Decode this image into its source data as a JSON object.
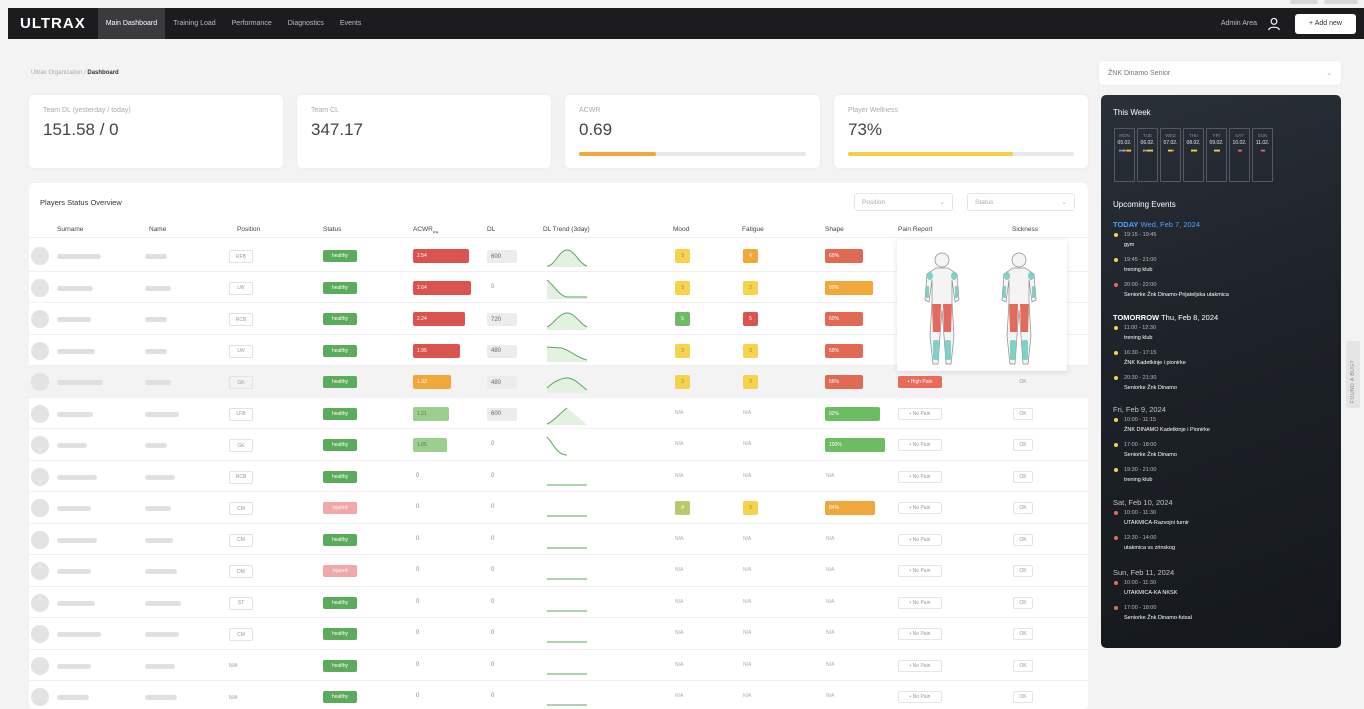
{
  "nav": {
    "logo": "ULTRAX",
    "items": [
      "Main Dashboard",
      "Training Load",
      "Performance",
      "Diagnostics",
      "Events"
    ],
    "admin": "Admin Area",
    "add_new": "+ Add new"
  },
  "breadcrumb": {
    "org": "Ultrax Organization",
    "sep": " / ",
    "page": "Dashboard"
  },
  "team_select": {
    "value": "ŽNK Dinamo Senior"
  },
  "cards": [
    {
      "label": "Team DL (yesterday / today)",
      "value": "151.58 / 0"
    },
    {
      "label": "Team CL",
      "value": "347.17"
    },
    {
      "label": "ACWR",
      "value": "0.69",
      "progress": 0.34,
      "color": "#f0a73b"
    },
    {
      "label": "Player Wellness",
      "value": "73%",
      "progress": 0.73,
      "color": "#f3cf45"
    }
  ],
  "players": {
    "title": "Players Status Overview",
    "filters": {
      "position": "Position",
      "status": "Status"
    },
    "headers": {
      "surname": "Surname",
      "name": "Name",
      "position": "Position",
      "status": "Status",
      "acwr": "ACWR",
      "acwr_sub": "RA",
      "dl": "DL",
      "dl_trend": "DL Trend (3day)",
      "mood": "Mood",
      "fatigue": "Fatigue",
      "shape": "Shape",
      "pain": "Pain Report",
      "sickness": "Sickness"
    },
    "rows": [
      {
        "position": "RFB",
        "status": "healthy",
        "acwr": "2.54",
        "dl": "600",
        "mood": "3",
        "fatigue": "4",
        "shape": "60%"
      },
      {
        "position": "LW",
        "status": "healthy",
        "acwr": "2.64",
        "dl": "0",
        "mood": "3",
        "fatigue": "2",
        "shape": "80%"
      },
      {
        "position": "RCB",
        "status": "healthy",
        "acwr": "2.24",
        "dl": "720",
        "mood": "5",
        "fatigue": "5",
        "shape": "60%"
      },
      {
        "position": "LW",
        "status": "healthy",
        "acwr": "1.95",
        "dl": "480",
        "mood": "3",
        "fatigue": "3",
        "shape": "59%"
      },
      {
        "position": "GK",
        "status": "healthy",
        "acwr": "1.33",
        "dl": "480",
        "mood": "3",
        "fatigue": "3",
        "shape": "56%",
        "pain": "• High Pain",
        "sickness": "OK"
      },
      {
        "position": "LFB",
        "status": "healthy",
        "acwr": "1.21",
        "dl": "600",
        "mood": "N/A",
        "fatigue": "N/A",
        "shape": "92%",
        "pain": "• No Pain",
        "sickness": "OK"
      },
      {
        "position": "GK",
        "status": "healthy",
        "acwr": "1.05",
        "dl": "0",
        "mood": "N/A",
        "fatigue": "N/A",
        "shape": "100%",
        "pain": "• No Pain",
        "sickness": "OK"
      },
      {
        "position": "RCB",
        "status": "healthy",
        "acwr": "0",
        "dl": "0",
        "mood": "N/A",
        "fatigue": "N/A",
        "shape": "N/A",
        "pain": "• No Pain",
        "sickness": "OK"
      },
      {
        "position": "CM",
        "status": "injured",
        "acwr": "0",
        "dl": "0",
        "mood": "4",
        "fatigue": "2",
        "shape": "84%",
        "pain": "• No Pain",
        "sickness": "OK"
      },
      {
        "position": "CM",
        "status": "healthy",
        "acwr": "0",
        "dl": "0",
        "mood": "N/A",
        "fatigue": "N/A",
        "shape": "N/A",
        "pain": "• No Pain",
        "sickness": "OK"
      },
      {
        "position": "DM",
        "status": "injured",
        "acwr": "0",
        "dl": "0",
        "mood": "N/A",
        "fatigue": "N/A",
        "shape": "N/A",
        "pain": "• No Pain",
        "sickness": "OK"
      },
      {
        "position": "ST",
        "status": "healthy",
        "acwr": "0",
        "dl": "0",
        "mood": "N/A",
        "fatigue": "N/A",
        "shape": "N/A",
        "pain": "• No Pain",
        "sickness": "OK"
      },
      {
        "position": "CM",
        "status": "healthy",
        "acwr": "0",
        "dl": "0",
        "mood": "N/A",
        "fatigue": "N/A",
        "shape": "N/A",
        "pain": "• No Pain",
        "sickness": "OK"
      },
      {
        "position": "N/A",
        "status": "healthy",
        "acwr": "0",
        "dl": "0",
        "mood": "N/A",
        "fatigue": "N/A",
        "shape": "N/A",
        "pain": "• No Pain",
        "sickness": "OK"
      },
      {
        "position": "N/A",
        "status": "healthy",
        "acwr": "0",
        "dl": "0",
        "mood": "N/A",
        "fatigue": "N/A",
        "shape": "N/A",
        "pain": "• No Pain",
        "sickness": "OK"
      }
    ]
  },
  "week": {
    "title": "This Week",
    "days": [
      {
        "name": "MON",
        "date": "05.02."
      },
      {
        "name": "TUE",
        "date": "06.02."
      },
      {
        "name": "WED",
        "date": "07.02."
      },
      {
        "name": "THU",
        "date": "08.02."
      },
      {
        "name": "FRI",
        "date": "09.02."
      },
      {
        "name": "SAT",
        "date": "10.02."
      },
      {
        "name": "SUN",
        "date": "11.02."
      }
    ]
  },
  "events": {
    "title": "Upcoming Events",
    "sections": [
      {
        "head": "TODAY",
        "date": "Wed, Feb 7, 2024",
        "items": [
          {
            "time": "19:15 - 19:45",
            "name": "gym"
          },
          {
            "time": "19:45 - 21:00",
            "name": "trening klub"
          },
          {
            "time": "20:00 - 22:00",
            "name": "Seniorke Žnk Dinamo-Prijateljska utakmica"
          }
        ]
      },
      {
        "head": "TOMORROW",
        "date": "Thu, Feb 8, 2024",
        "items": [
          {
            "time": "11:00 - 12:30",
            "name": "trening klub"
          },
          {
            "time": "16:30 - 17:15",
            "name": "ŽNK Kadetkinje i pionirke"
          },
          {
            "time": "20:30 - 21:30",
            "name": "Seniorke Žnk Dinamo"
          }
        ]
      },
      {
        "head": "",
        "date": "Fri, Feb 9, 2024",
        "items": [
          {
            "time": "10:00 - 11:15",
            "name": "ŽNK DINAMO Kadetkinje i Pionirke"
          },
          {
            "time": "17:00 - 18:00",
            "name": "Seniorke Žnk Dinamo"
          },
          {
            "time": "19:30 - 21:00",
            "name": "trening klub"
          }
        ]
      },
      {
        "head": "",
        "date": "Sat, Feb 10, 2024",
        "items": [
          {
            "time": "10:00 - 11:30",
            "name": "UTAKMICA-Razvojni turnir"
          },
          {
            "time": "12:30 - 14:00",
            "name": "utakmica vs zrinskog"
          }
        ]
      },
      {
        "head": "",
        "date": "Sun, Feb 11, 2024",
        "items": [
          {
            "time": "10:00 - 11:30",
            "name": "UTAKMICA-KA NKSK"
          },
          {
            "time": "17:00 - 18:00",
            "name": "Seniorke Žnk Dinamo-futsal"
          }
        ]
      }
    ]
  },
  "feedback": "FOUND A BUG?",
  "colors": {
    "healthy": "#5cab5c",
    "injured": "#f0a8a8",
    "red": "#d9534f",
    "orange": "#f0a73b",
    "yellow": "#f5d34d",
    "green": "#6dbb63",
    "lightgreen": "#9ccf8f",
    "today": "#4aa3ff"
  }
}
